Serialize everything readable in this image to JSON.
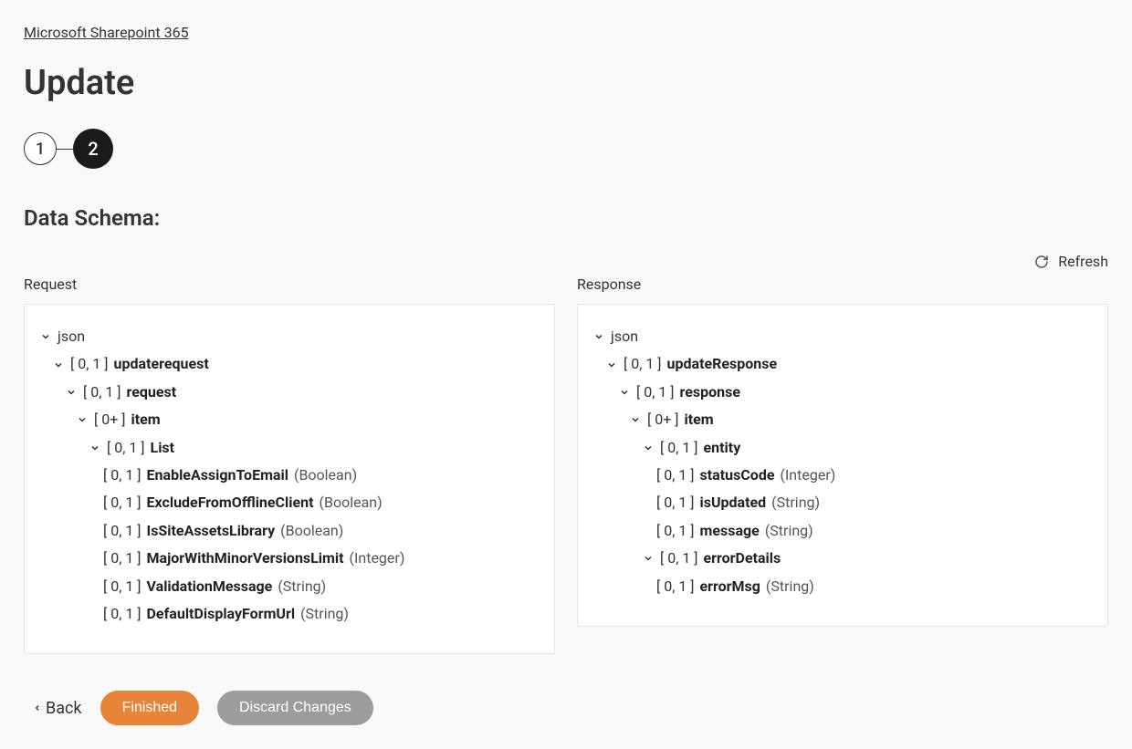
{
  "breadcrumb": "Microsoft Sharepoint 365",
  "page_title": "Update",
  "stepper": {
    "step1": "1",
    "step2": "2"
  },
  "section_title": "Data Schema:",
  "refresh_label": "Refresh",
  "columns": {
    "request_label": "Request",
    "response_label": "Response"
  },
  "request_tree": {
    "root": {
      "name": "json"
    },
    "n1": {
      "card": "[ 0, 1 ]",
      "name": "updaterequest"
    },
    "n2": {
      "card": "[ 0, 1 ]",
      "name": "request"
    },
    "n3": {
      "card": "[ 0+ ]",
      "name": "item"
    },
    "n4": {
      "card": "[ 0, 1 ]",
      "name": "List"
    },
    "l1": {
      "card": "[ 0, 1 ]",
      "name": "EnableAssignToEmail",
      "type": "(Boolean)"
    },
    "l2": {
      "card": "[ 0, 1 ]",
      "name": "ExcludeFromOfflineClient",
      "type": "(Boolean)"
    },
    "l3": {
      "card": "[ 0, 1 ]",
      "name": "IsSiteAssetsLibrary",
      "type": "(Boolean)"
    },
    "l4": {
      "card": "[ 0, 1 ]",
      "name": "MajorWithMinorVersionsLimit",
      "type": "(Integer)"
    },
    "l5": {
      "card": "[ 0, 1 ]",
      "name": "ValidationMessage",
      "type": "(String)"
    },
    "l6": {
      "card": "[ 0, 1 ]",
      "name": "DefaultDisplayFormUrl",
      "type": "(String)"
    }
  },
  "response_tree": {
    "root": {
      "name": "json"
    },
    "n1": {
      "card": "[ 0, 1 ]",
      "name": "updateResponse"
    },
    "n2": {
      "card": "[ 0, 1 ]",
      "name": "response"
    },
    "n3": {
      "card": "[ 0+ ]",
      "name": "item"
    },
    "n4": {
      "card": "[ 0, 1 ]",
      "name": "entity"
    },
    "l1": {
      "card": "[ 0, 1 ]",
      "name": "statusCode",
      "type": "(Integer)"
    },
    "l2": {
      "card": "[ 0, 1 ]",
      "name": "isUpdated",
      "type": "(String)"
    },
    "l3": {
      "card": "[ 0, 1 ]",
      "name": "message",
      "type": "(String)"
    },
    "n5": {
      "card": "[ 0, 1 ]",
      "name": "errorDetails"
    },
    "l4": {
      "card": "[ 0, 1 ]",
      "name": "errorMsg",
      "type": "(String)"
    }
  },
  "footer": {
    "back": "Back",
    "finished": "Finished",
    "discard": "Discard Changes"
  }
}
